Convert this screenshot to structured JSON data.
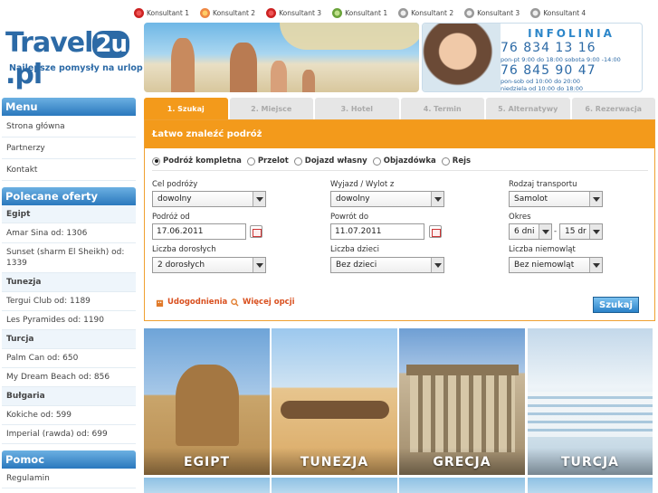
{
  "logo": {
    "brand_a": "Travel",
    "brand_b": "2u",
    "brand_c": ".pl",
    "slogan": "Najlepsze pomysły na urlop"
  },
  "consultants": [
    {
      "label": "Konsultant 1",
      "icon": "skype-red-icon"
    },
    {
      "label": "Konsultant 2",
      "icon": "skype-orange-icon"
    },
    {
      "label": "Konsultant 3",
      "icon": "skype-red-icon"
    },
    {
      "label": "Konsultant 1",
      "icon": "gg-green-icon"
    },
    {
      "label": "Konsultant 2",
      "icon": "gg-gray-icon"
    },
    {
      "label": "Konsultant 3",
      "icon": "gg-gray-icon"
    },
    {
      "label": "Konsultant 4",
      "icon": "gg-gray-icon"
    }
  ],
  "infolinia": {
    "title": "INFOLINIA",
    "phone1": "76 834 13 16",
    "hours1": "pon-pt 9:00 do 18:00   sobota 9:00 -14:00",
    "phone2": "76 845 90 47",
    "hours2a": "pon-sob od 10:00 do 20:00",
    "hours2b": "niedziela od 10:00 do 18:00"
  },
  "sidebar": {
    "menu_title": "Menu",
    "menu": [
      "Strona główna",
      "Partnerzy",
      "Kontakt"
    ],
    "offers_title": "Polecane oferty",
    "offers": [
      {
        "type": "country",
        "text": "Egipt"
      },
      {
        "type": "item",
        "text": "Amar Sina od: 1306"
      },
      {
        "type": "item2",
        "text": "Sunset (sharm El Sheikh) od: 1339"
      },
      {
        "type": "country",
        "text": "Tunezja"
      },
      {
        "type": "item",
        "text": "Tergui Club od: 1189"
      },
      {
        "type": "item",
        "text": "Les Pyramides od: 1190"
      },
      {
        "type": "country",
        "text": "Turcja"
      },
      {
        "type": "item",
        "text": "Palm Can od: 650"
      },
      {
        "type": "item",
        "text": "My Dream Beach od: 856"
      },
      {
        "type": "country",
        "text": "Bułgaria"
      },
      {
        "type": "item",
        "text": "Kokiche od: 599"
      },
      {
        "type": "item",
        "text": "Imperial (rawda) od: 699"
      }
    ],
    "help_title": "Pomoc",
    "help": [
      "Regulamin"
    ]
  },
  "tabs": [
    "1. Szukaj",
    "2. Miejsce",
    "3. Hotel",
    "4. Termin",
    "5. Alternatywy",
    "6. Rezerwacja"
  ],
  "search": {
    "heading": "Łatwo znaleźć podróż",
    "radios": [
      {
        "label": "Podróż kompletna",
        "checked": true
      },
      {
        "label": "Przelot",
        "checked": false
      },
      {
        "label": "Dojazd własny",
        "checked": false
      },
      {
        "label": "Objazdówka",
        "checked": false
      },
      {
        "label": "Rejs",
        "checked": false
      }
    ],
    "cel_label": "Cel podróży",
    "cel_value": "dowolny",
    "wyjazd_label": "Wyjazd / Wylot z",
    "wyjazd_value": "dowolny",
    "transport_label": "Rodzaj transportu",
    "transport_value": "Samolot",
    "od_label": "Podróż od",
    "od_value": "17.06.2011",
    "powrot_label": "Powrót do",
    "powrot_value": "11.07.2011",
    "okres_label": "Okres",
    "okres_from": "6 dni",
    "okres_to": "15 dr",
    "dorosli_label": "Liczba dorosłych",
    "dorosli_value": "2 dorosłych",
    "dzieci_label": "Liczba dzieci",
    "dzieci_value": "Bez dzieci",
    "niemowlat_label": "Liczba niemowląt",
    "niemowlat_value": "Bez niemowląt",
    "link_udogodnienia": "Udogodnienia",
    "link_opcje": "Więcej opcji",
    "submit": "Szukaj"
  },
  "destinations": [
    "EGIPT",
    "TUNEZJA",
    "GRECJA",
    "TURCJA"
  ]
}
